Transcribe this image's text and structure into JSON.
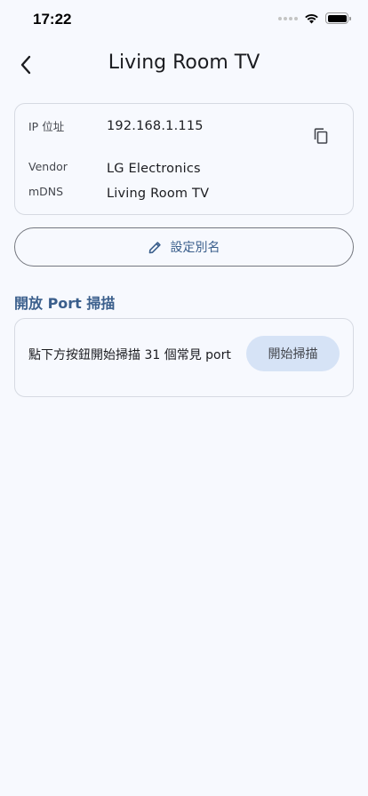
{
  "status_bar": {
    "time": "17:22"
  },
  "header": {
    "title": "Living Room TV"
  },
  "device_info": {
    "rows": [
      {
        "label": "IP 位址",
        "value": "192.168.1.115"
      },
      {
        "label": "Vendor",
        "value": "LG Electronics"
      },
      {
        "label": "mDNS",
        "value": "Living Room TV"
      }
    ]
  },
  "alias_button": {
    "label": "設定別名"
  },
  "port_scan": {
    "title": "開放 Port 掃描",
    "description": "點下方按鈕開始掃描 31 個常見 port",
    "button_label": "開始掃描"
  },
  "icons": {
    "back": "chevron-left-icon",
    "copy": "copy-icon",
    "edit": "pencil-icon"
  },
  "colors": {
    "background": "#f7f9fe",
    "accent": "#3b5f8c",
    "scan_button_bg": "#d6e3f6"
  }
}
